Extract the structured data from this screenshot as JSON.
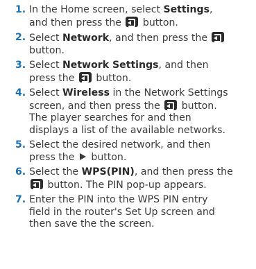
{
  "steps": [
    {
      "num": "1.",
      "a": "In the Home screen, select ",
      "kw": "Settings",
      "b": ",",
      "c": "and then press the ",
      "d": " button."
    },
    {
      "num": "2.",
      "a": "Select ",
      "kw": "Network",
      "b": ", and then press the ",
      "c": "button."
    },
    {
      "num": "3.",
      "a": "Select ",
      "kw": "Network Settings",
      "b": ", and then",
      "c": "press the ",
      "d": " button."
    },
    {
      "num": "4.",
      "a": "Select ",
      "kw": "Wireless",
      "b": " in the Network Settings",
      "c": "screen, and then press the ",
      "d": " button.",
      "e": "The player searches for and then",
      "f": "displays a list of the available networks."
    },
    {
      "num": "5.",
      "a": "Select the desired network, and then",
      "b": "press the ",
      "c": " button."
    },
    {
      "num": "6.",
      "a": "Select the ",
      "kw": "WPS(PIN)",
      "b": ", and then press the",
      "c": " button. The PIN pop-up appears."
    },
    {
      "num": "7.",
      "a": "Enter the PIN into the WPS PIN entry",
      "b": "field in the router's Set Up screen and",
      "c": "then save the the screen."
    }
  ],
  "icons": {
    "enter": "enter-button-icon",
    "play": "play-button-icon"
  },
  "colors": {
    "step_number": "#1b6fb3",
    "text": "#3a3a3a",
    "icon_bg": "#2b2b2b"
  }
}
